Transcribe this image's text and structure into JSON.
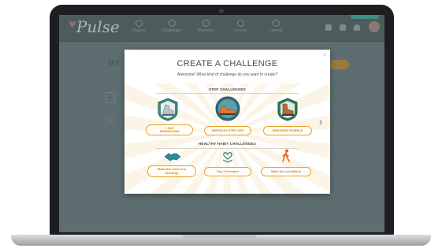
{
  "app": {
    "logo_text": "Pulse",
    "nav": [
      {
        "label": "Explore",
        "icon": "compass-icon"
      },
      {
        "label": "Challenges",
        "icon": "trophy-icon"
      },
      {
        "label": "Rewards",
        "icon": "gift-icon"
      },
      {
        "label": "Groups",
        "icon": "people-icon"
      },
      {
        "label": "Friends",
        "icon": "friends-icon"
      }
    ],
    "page_title": "MY",
    "colors": {
      "brand_accent": "#e7a12a",
      "brand_text": "#d97f15",
      "teal": "#3f8e88"
    }
  },
  "modal": {
    "title": "CREATE A CHALLENGE",
    "subtitle": "Awesome! What kind of challenge do you want to create?",
    "close_label": "×",
    "step_section_label": "STEP CHALLENGES",
    "habit_section_label": "HEALTHY HABIT CHALLENGES",
    "step_challenges": [
      {
        "label": "7 DAY\nSHOWDOWN",
        "icon": "shoe-badge-icon"
      },
      {
        "label": "WEEKDAY STEP-OFF",
        "icon": "sneaker-badge-icon"
      },
      {
        "label": "WEEKEND RUMBLE",
        "icon": "boot-badge-icon"
      }
    ],
    "habit_challenges": [
      {
        "label": "Make the most of a\nmeeting!",
        "icon": "handshake-icon"
      },
      {
        "label": "Pay it Forward",
        "icon": "heart-hand-icon"
      },
      {
        "label": "Walk the Last Block",
        "icon": "walking-person-icon"
      }
    ],
    "prev_label": "‹",
    "next_label": "›"
  }
}
